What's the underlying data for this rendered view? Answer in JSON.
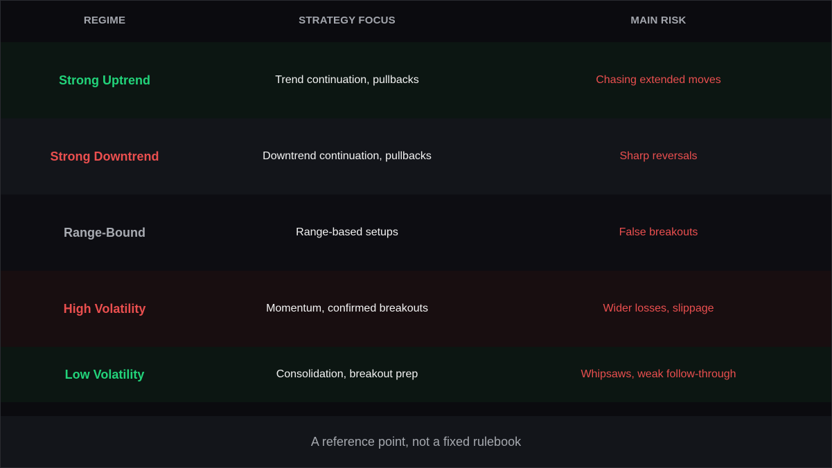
{
  "header": {
    "regime": "REGIME",
    "strategy": "STRATEGY FOCUS",
    "risk": "MAIN RISK"
  },
  "rows": [
    {
      "regime": "Strong Uptrend",
      "strategy": "Trend continuation, pullbacks",
      "risk": "Chasing extended moves",
      "regime_color": "#22d37a",
      "background": "#0c1612"
    },
    {
      "regime": "Strong Downtrend",
      "strategy": "Downtrend continuation, pullbacks",
      "risk": "Sharp reversals",
      "regime_color": "#ea4f4f",
      "background": "#13151a"
    },
    {
      "regime": "Range-Bound",
      "strategy": "Range-based setups",
      "risk": "False breakouts",
      "regime_color": "#a8abb2",
      "background": "#0d0d12"
    },
    {
      "regime": "High Volatility",
      "strategy": "Momentum, confirmed breakouts",
      "risk": "Wider losses, slippage",
      "regime_color": "#ea4f4f",
      "background": "#180e10"
    },
    {
      "regime": "Low Volatility",
      "strategy": "Consolidation, breakout prep",
      "risk": "Whipsaws, weak follow-through",
      "regime_color": "#22d37a",
      "background": "#0c1612"
    }
  ],
  "footer": {
    "text": "A reference point, not a fixed rulebook"
  },
  "colors": {
    "page_background": "#0b0b0f",
    "header_text": "#a3a6ad",
    "strategy_text": "#f2f2f2",
    "risk_text": "#ea4f4f",
    "footer_background": "#13151a",
    "footer_text": "#a5a8ae"
  }
}
